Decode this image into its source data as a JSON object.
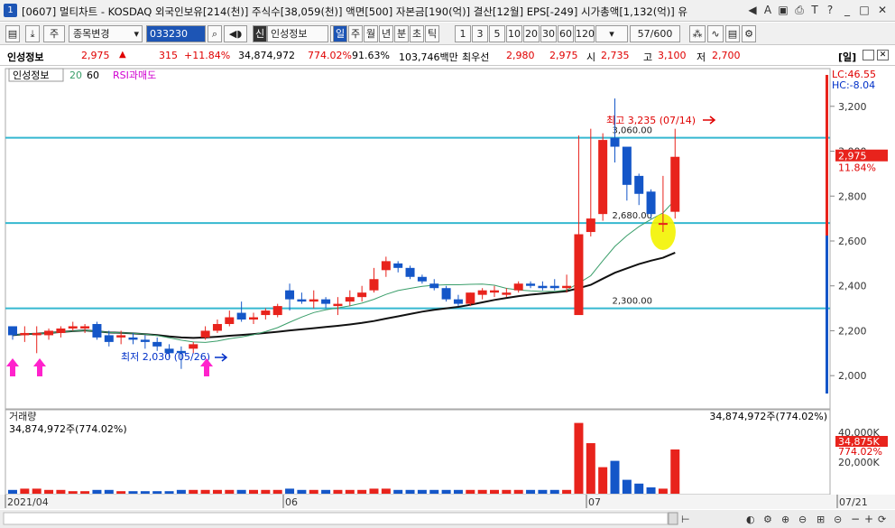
{
  "window": {
    "badge": "1",
    "title": "[0607] 멀티차트 - KOSDAQ 외국인보유[214(천)] 주식수[38,059(천)] 액면[500] 자본금[190(억)] 결산[12월] EPS[-249] 시가총액[1,132(억)] 유",
    "icons": [
      "back-icon",
      "font-a-icon",
      "restore-icon",
      "print-icon",
      "text-size-icon",
      "help-icon",
      "minimize-icon",
      "maximize-icon",
      "close-icon"
    ]
  },
  "toolbar": {
    "market": "주",
    "mode": "종목변경",
    "code": "033230",
    "name_flag": "신",
    "stock_name": "인성정보",
    "periods": [
      "일",
      "주",
      "월",
      "년",
      "분",
      "초",
      "틱"
    ],
    "active_period": "일",
    "intervals": [
      "1",
      "3",
      "5",
      "10",
      "20",
      "30",
      "60",
      "120"
    ],
    "count": "57/600"
  },
  "quote": {
    "name": "인성정보",
    "price": "2,975",
    "change_arrow": "▲",
    "change": "315",
    "change_pct": "+11.84%",
    "volume": "34,874,972",
    "volume_pct": "774.02%",
    "turnover": "91.63%",
    "amount": "103,746백만",
    "label_bid": "최우선",
    "bid": "2,980",
    "ask": "2,975",
    "label_open": "시",
    "open": "2,735",
    "label_high": "고",
    "high": "3,100",
    "label_low": "저",
    "low": "2,700",
    "view_label": "[일]"
  },
  "legend": {
    "name": "인성정보",
    "ma1": "20",
    "ma2": "60",
    "indicator": "RSI과매도"
  },
  "annotations": {
    "high": "최고 3,235 (07/14)",
    "low": "최저 2,030 (05/26)",
    "level_3060": "3,060.00",
    "level_2680": "2,680.00",
    "level_2300": "2,300.00",
    "lc": "LC:46.55",
    "hc": "HC:-8.04",
    "price_tag": "2,975",
    "pct_tag": "11.84%"
  },
  "volume_panel": {
    "title": "거래량",
    "value": "34,874,972주(774.02%)",
    "value_right": "34,874,972주(774.02%)",
    "tag": "34,875K",
    "tag_pct": "774.02%"
  },
  "dates": [
    "2021/04",
    "06",
    "07",
    "07/21"
  ],
  "colors": {
    "up": "#e8231c",
    "down": "#1456c8",
    "hline": "#35b8d0",
    "ma20": "#3a9e6a",
    "ma60": "#111111",
    "highlight": "#f3f300",
    "marker": "#ff22cc"
  },
  "chart_data": {
    "type": "candlestick",
    "y_ticks": [
      2000,
      2200,
      2400,
      2600,
      2800,
      3000,
      3200
    ],
    "vol_ticks": [
      "40,000K",
      "20,000K"
    ],
    "ylim": [
      1860,
      3360
    ],
    "hlines": [
      3060,
      2680,
      2300
    ],
    "candles": [
      [
        2220,
        2220,
        2160,
        2180,
        3
      ],
      [
        2180,
        2220,
        2150,
        2190,
        4
      ],
      [
        2180,
        2220,
        2100,
        2190,
        4
      ],
      [
        2180,
        2210,
        2160,
        2200,
        3
      ],
      [
        2190,
        2220,
        2170,
        2210,
        3
      ],
      [
        2210,
        2240,
        2200,
        2220,
        2
      ],
      [
        2210,
        2230,
        2190,
        2220,
        2
      ],
      [
        2230,
        2240,
        2160,
        2170,
        3
      ],
      [
        2180,
        2200,
        2130,
        2150,
        3
      ],
      [
        2170,
        2200,
        2140,
        2180,
        2
      ],
      [
        2170,
        2190,
        2140,
        2160,
        2
      ],
      [
        2160,
        2180,
        2120,
        2150,
        2
      ],
      [
        2150,
        2170,
        2110,
        2130,
        2
      ],
      [
        2120,
        2140,
        2080,
        2100,
        2
      ],
      [
        2110,
        2130,
        2030,
        2100,
        3
      ],
      [
        2120,
        2150,
        2100,
        2140,
        3
      ],
      [
        2170,
        2220,
        2160,
        2200,
        3
      ],
      [
        2200,
        2250,
        2190,
        2230,
        3
      ],
      [
        2230,
        2290,
        2220,
        2260,
        3
      ],
      [
        2280,
        2330,
        2240,
        2250,
        3
      ],
      [
        2250,
        2280,
        2230,
        2260,
        3
      ],
      [
        2270,
        2300,
        2250,
        2290,
        3
      ],
      [
        2270,
        2320,
        2260,
        2310,
        3
      ],
      [
        2380,
        2410,
        2290,
        2340,
        4
      ],
      [
        2340,
        2370,
        2320,
        2330,
        3
      ],
      [
        2330,
        2380,
        2300,
        2340,
        3
      ],
      [
        2340,
        2350,
        2300,
        2320,
        3
      ],
      [
        2310,
        2350,
        2270,
        2320,
        3
      ],
      [
        2330,
        2380,
        2310,
        2350,
        3
      ],
      [
        2350,
        2400,
        2330,
        2370,
        3
      ],
      [
        2380,
        2480,
        2370,
        2430,
        4
      ],
      [
        2470,
        2530,
        2440,
        2510,
        4
      ],
      [
        2500,
        2510,
        2460,
        2480,
        3
      ],
      [
        2480,
        2490,
        2430,
        2440,
        3
      ],
      [
        2440,
        2450,
        2410,
        2420,
        3
      ],
      [
        2410,
        2430,
        2380,
        2390,
        3
      ],
      [
        2390,
        2400,
        2330,
        2340,
        3
      ],
      [
        2340,
        2360,
        2310,
        2320,
        3
      ],
      [
        2320,
        2370,
        2310,
        2370,
        3
      ],
      [
        2360,
        2390,
        2340,
        2380,
        3
      ],
      [
        2370,
        2400,
        2350,
        2380,
        3
      ],
      [
        2360,
        2390,
        2350,
        2370,
        3
      ],
      [
        2380,
        2420,
        2370,
        2410,
        3
      ],
      [
        2410,
        2420,
        2390,
        2400,
        3
      ],
      [
        2400,
        2420,
        2380,
        2390,
        3
      ],
      [
        2400,
        2430,
        2380,
        2390,
        3
      ],
      [
        2390,
        2450,
        2370,
        2400,
        3
      ],
      [
        2270,
        3070,
        2270,
        2630,
        56
      ],
      [
        2640,
        3100,
        2620,
        2700,
        40
      ],
      [
        2720,
        3080,
        2690,
        3050,
        21
      ],
      [
        3060,
        3235,
        2950,
        3020,
        26
      ],
      [
        3020,
        3000,
        2780,
        2850,
        11
      ],
      [
        2890,
        2900,
        2760,
        2810,
        8
      ],
      [
        2820,
        2830,
        2700,
        2720,
        5
      ],
      [
        2680,
        2890,
        2640,
        2680,
        4
      ],
      [
        2730,
        3100,
        2700,
        2975,
        35
      ]
    ],
    "annotations": [
      "최고 3,235 (07/14)",
      "최저 2,030 (05/26)"
    ]
  }
}
